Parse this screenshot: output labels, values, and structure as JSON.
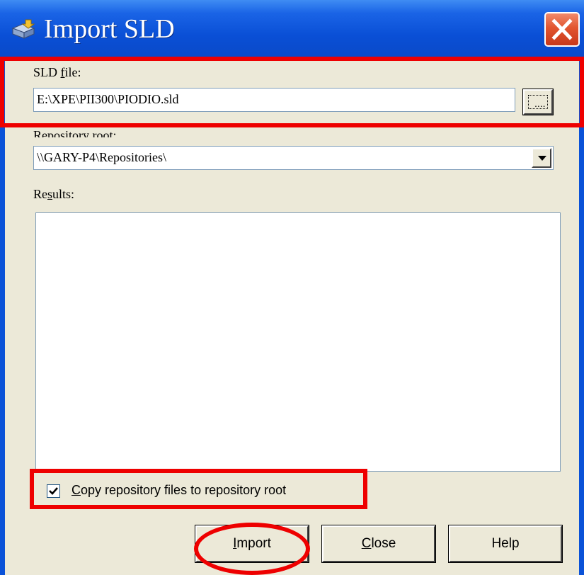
{
  "window": {
    "title": "Import SLD"
  },
  "icons": {
    "app_icon": "import-sld-icon",
    "close_icon": "close-icon",
    "browse_icon": "ellipsis-icon",
    "dropdown_icon": "chevron-down-icon",
    "checkbox_icon": "checkmark-icon"
  },
  "form": {
    "sld_file": {
      "label_mnemonic": "SLD ",
      "label_underlined": "f",
      "label_rest": "ile:",
      "value": "E:\\XPE\\PII300\\PIODIO.sld",
      "browse_label": "...."
    },
    "repository_root": {
      "label": "Repository root:",
      "value": "\\\\GARY-P4\\Repositories\\"
    },
    "results": {
      "label_pre": "Re",
      "label_underlined": "s",
      "label_rest": "ults:",
      "content": ""
    },
    "copy_option": {
      "checked": true,
      "label_underlined": "C",
      "label_rest": "opy repository files to repository root"
    }
  },
  "buttons": {
    "import": {
      "underlined": "I",
      "rest": "mport"
    },
    "close": {
      "underlined": "C",
      "rest": "lose"
    },
    "help": {
      "label": "Help"
    }
  },
  "colors": {
    "titlebar": "#0a4fd6",
    "client_background": "#ece9d8",
    "annotation": "#ee0000",
    "close_button": "#e2552f"
  }
}
